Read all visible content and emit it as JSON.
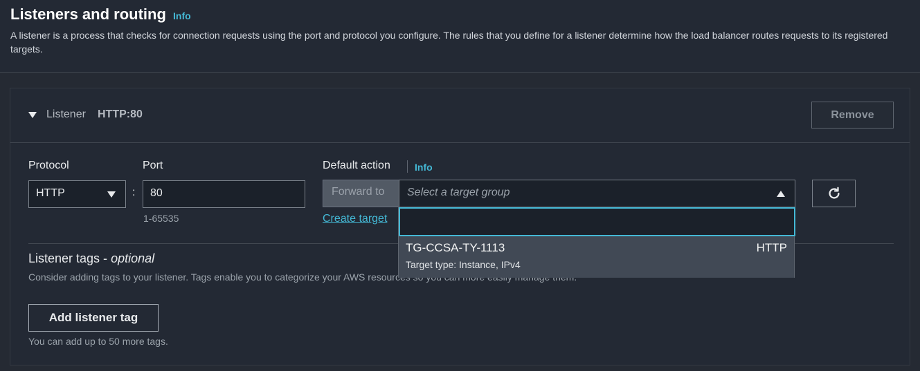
{
  "section": {
    "title": "Listeners and routing",
    "info": "Info",
    "description": "A listener is a process that checks for connection requests using the port and protocol you configure. The rules that you define for a listener determine how the load balancer routes requests to its registered targets."
  },
  "listener": {
    "label": "Listener",
    "value": "HTTP:80",
    "remove": "Remove",
    "protocol_label": "Protocol",
    "protocol_value": "HTTP",
    "port_label": "Port",
    "port_value": "80",
    "port_hint": "1-65535",
    "default_action_label": "Default action",
    "default_action_info": "Info",
    "forward_to": "Forward to",
    "target_group_placeholder": "Select a target group",
    "create_target_link": "Create target"
  },
  "tags": {
    "title": "Listener tags - ",
    "title_optional": "optional",
    "description": "Consider adding tags to your listener. Tags enable you to categorize your AWS resources so you can more easily manage them.",
    "add_button": "Add listener tag",
    "hint": "You can add up to 50 more tags."
  },
  "dropdown": {
    "search_value": "",
    "options": [
      {
        "name": "TG-CCSA-TY-1113",
        "protocol": "HTTP",
        "subtitle": "Target type: Instance, IPv4"
      }
    ]
  },
  "icons": {
    "expand": "caret-down-icon",
    "select": "caret-down-icon",
    "dropdown_open": "caret-up-icon",
    "refresh": "refresh-icon",
    "search": "search-icon"
  },
  "colors": {
    "accent": "#44b9d6",
    "background": "#232934"
  }
}
